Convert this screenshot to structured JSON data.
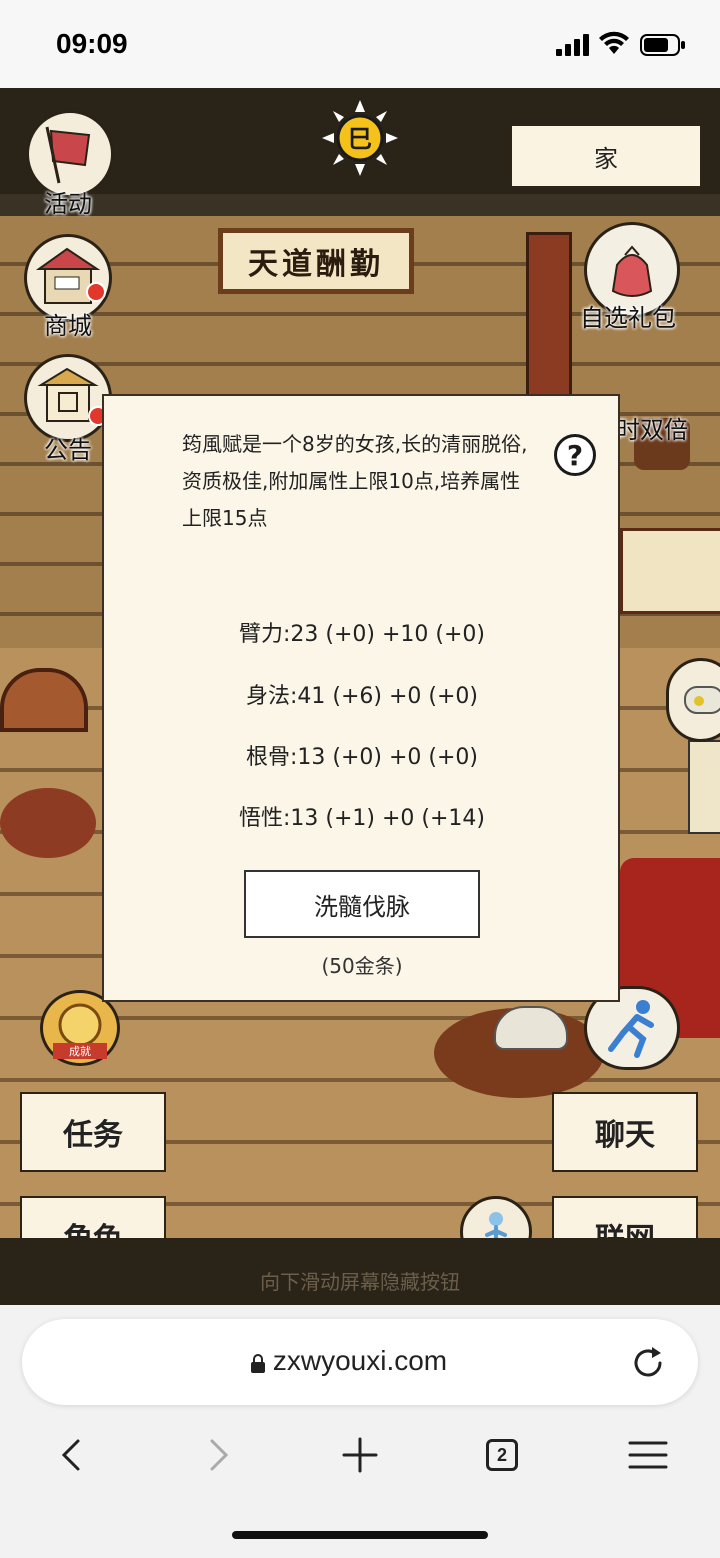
{
  "status_bar": {
    "time": "09:09"
  },
  "game": {
    "home_button": "家",
    "plaque_text": "天道酬勤",
    "icons": {
      "activity": "活动",
      "shop": "商城",
      "notice": "公告",
      "gift_pack": "自选礼包",
      "double": "时双倍"
    },
    "buttons": {
      "task": "任务",
      "role": "角色",
      "chat": "聊天",
      "network": "联网"
    },
    "scroll_hint": "向下滑动屏幕隐藏按钮"
  },
  "modal": {
    "description": "筠風赋是一个8岁的女孩,长的清丽脱俗,资质极佳,附加属性上限10点,培养属性上限15点",
    "help_symbol": "?",
    "stats": [
      "臂力:23 (+0) +10 (+0)",
      "身法:41 (+6) +0 (+0)",
      "根骨:13 (+0) +0 (+0)",
      "悟性:13 (+1) +0 (+14)"
    ],
    "action_button": "洗髓伐脉",
    "cost": "(50金条)"
  },
  "browser": {
    "url": "zxwyouxi.com",
    "tab_count": "2"
  }
}
